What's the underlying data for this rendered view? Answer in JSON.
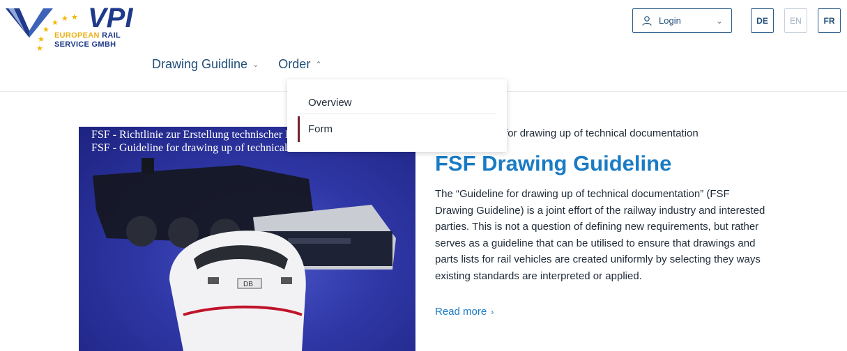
{
  "logo": {
    "name": "VPI",
    "line1_a": "EUROPEAN ",
    "line1_b": "RAIL",
    "line2": "SERVICE GMBH"
  },
  "nav": {
    "items": [
      {
        "label": "Drawing Guidline",
        "chevron": "chevron-down-icon"
      },
      {
        "label": "Order",
        "chevron": "chevron-up-icon"
      }
    ]
  },
  "header": {
    "login_label": "Login",
    "languages": [
      {
        "code": "DE",
        "active": true
      },
      {
        "code": "EN",
        "active": false
      },
      {
        "code": "FR",
        "active": true
      }
    ]
  },
  "dropdown": {
    "items": [
      {
        "label": "Overview"
      },
      {
        "label": "Form"
      }
    ]
  },
  "hero": {
    "caption_line1": "FSF - Richtlinie zur Erstellung technischer Dokumentation",
    "caption_line2": "FSF - Guideline for drawing up of technical documentation"
  },
  "article": {
    "overline": "FSF Guideline for drawing up of technical documentation",
    "title": "FSF Drawing Guideline",
    "body": "The “Guideline for drawing up of technical documentation” (FSF Drawing Guideline) is a joint effort of the railway industry and interested parties. This is not a question of defining new requirements, but rather serves as a guideline that can be utilised to ensure that drawings and parts lists for rail vehicles are created uniformly by selecting they ways existing standards are interpreted or applied.",
    "read_more": "Read more"
  },
  "colors": {
    "brand_blue": "#1f3a8a",
    "accent_blue": "#1a7bc4",
    "star_yellow": "#f2b600",
    "active_marker": "#7a1d2e"
  }
}
